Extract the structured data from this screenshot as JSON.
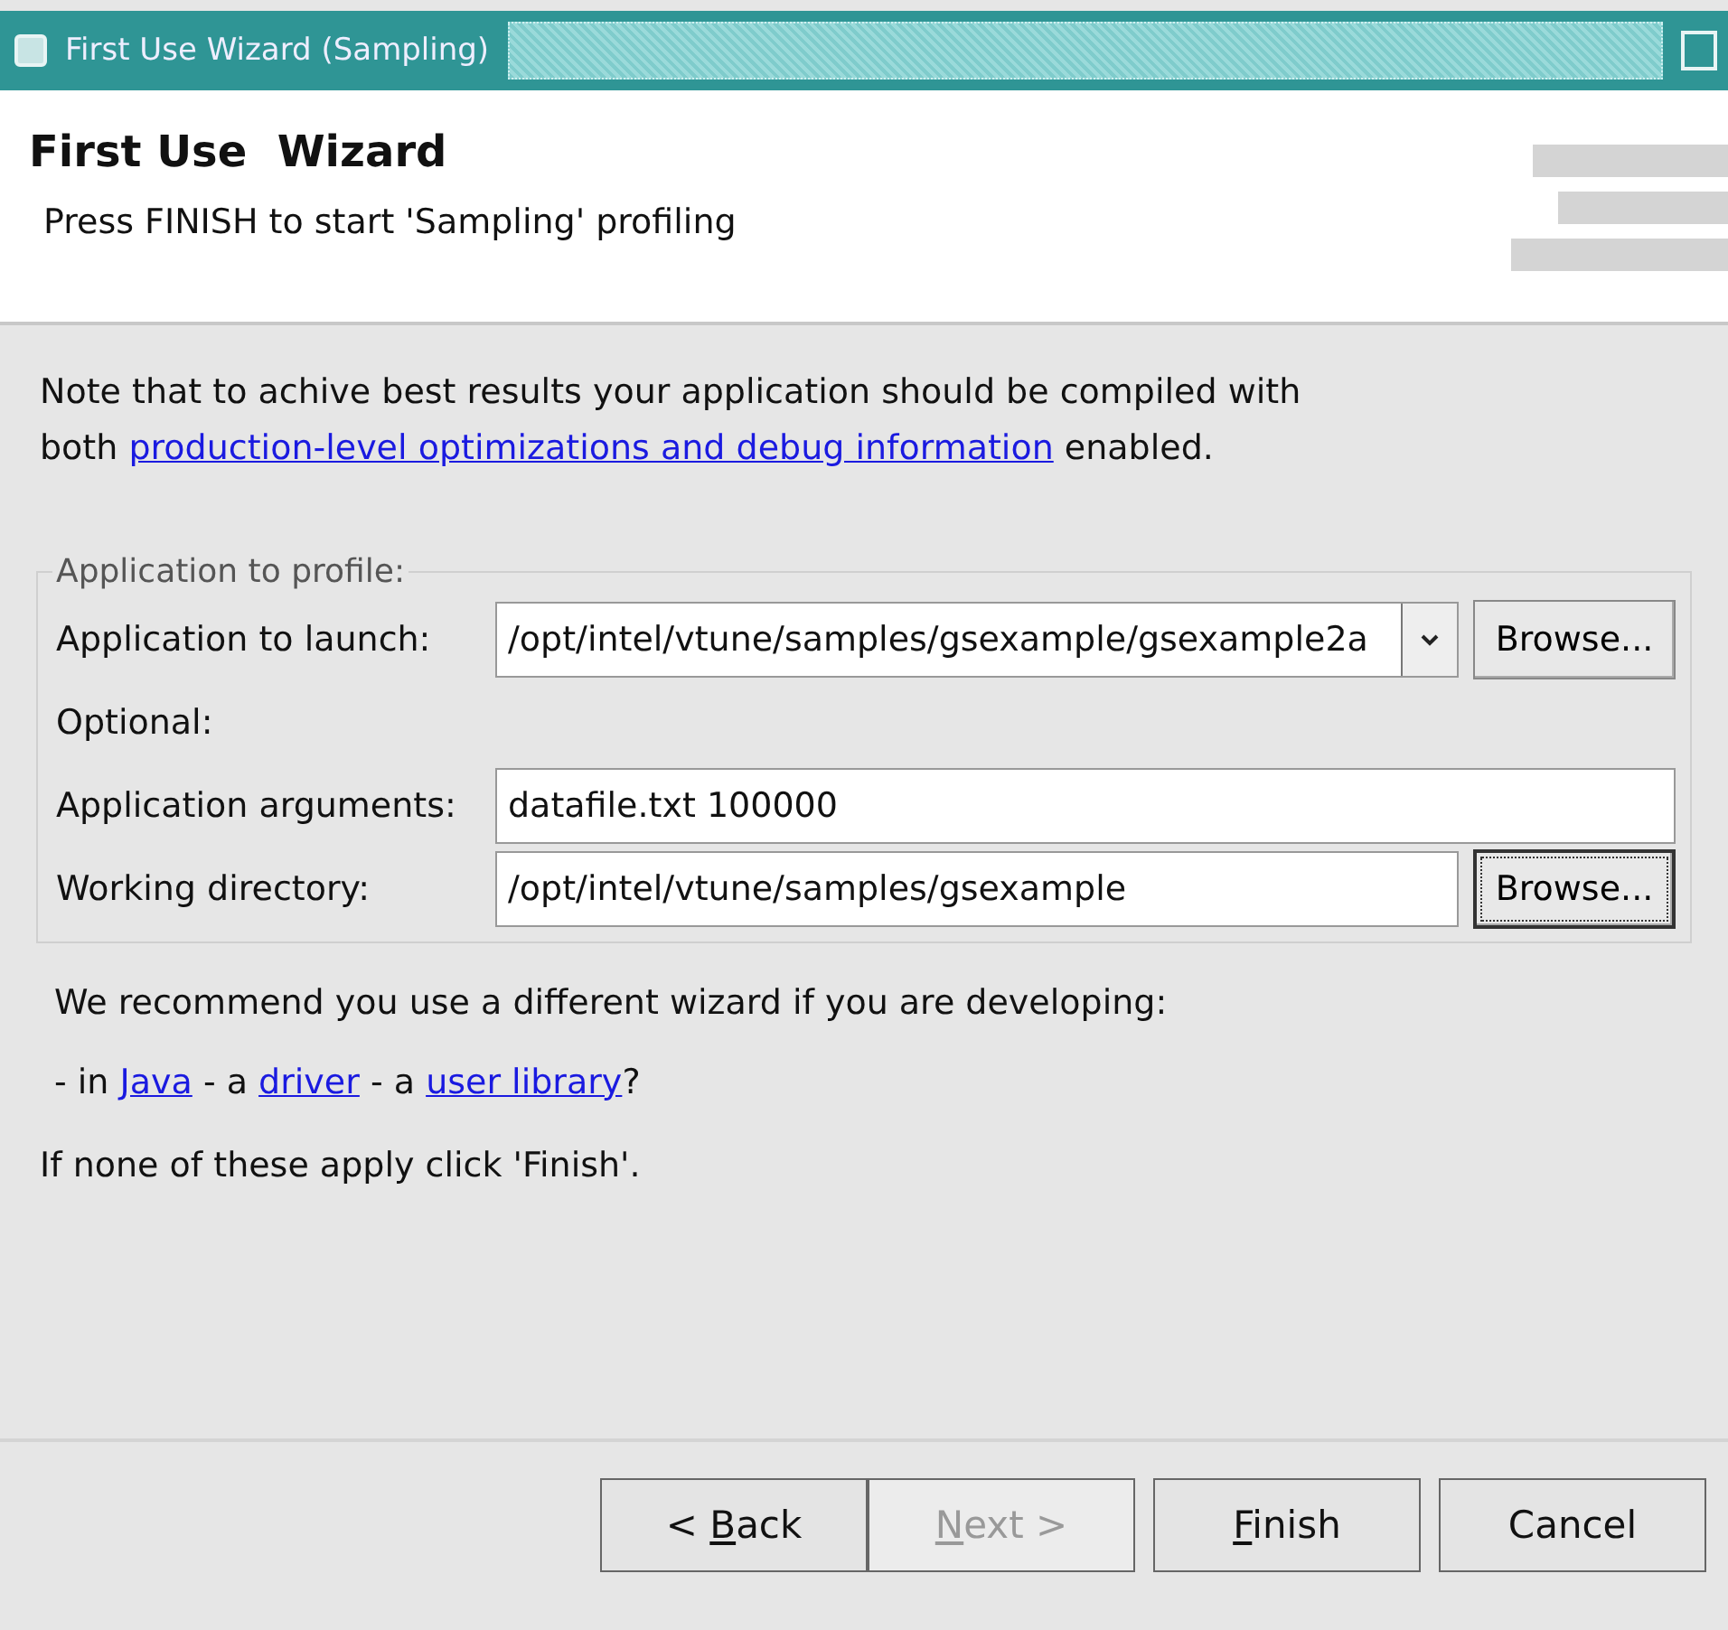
{
  "window": {
    "title": "First Use Wizard (Sampling)"
  },
  "header": {
    "title": "First Use  Wizard",
    "subtitle": "Press FINISH to start 'Sampling' profiling"
  },
  "note": [
    {
      "kind": "text",
      "text": "Note that to achive best results your application should be compiled with both "
    },
    {
      "kind": "link",
      "text": "production-level optimizations and debug information"
    },
    {
      "kind": "text",
      "text": " enabled."
    }
  ],
  "group": {
    "legend": "Application to profile:",
    "launch": {
      "label": "Application to launch:",
      "value": "/opt/intel/vtune/samples/gsexample/gsexample2a",
      "button": "Browse..."
    },
    "optional_label": "Optional:",
    "arguments": {
      "label": "Application arguments:",
      "value": "datafile.txt 100000"
    },
    "directory": {
      "label": "Working directory:",
      "value": "/opt/intel/vtune/samples/gsexample",
      "button": "Browse...",
      "button_focused": true
    }
  },
  "recommend": "We recommend you use a different wizard if you are developing:",
  "choices": [
    {
      "kind": "text",
      "text": "- in "
    },
    {
      "kind": "link",
      "text": "Java"
    },
    {
      "kind": "text",
      "text": " - a "
    },
    {
      "kind": "link",
      "text": "driver"
    },
    {
      "kind": "text",
      "text": " - a "
    },
    {
      "kind": "link",
      "text": "user library"
    },
    {
      "kind": "text",
      "text": "?"
    }
  ],
  "footer_note": "If none of these apply click 'Finish'.",
  "buttons": [
    {
      "before": "< ",
      "key": "B",
      "after": "ack",
      "disabled": false
    },
    {
      "key": "N",
      "after": "ext >",
      "disabled": true
    },
    {
      "key": "F",
      "after": "inish",
      "disabled": false
    },
    {
      "before": "Cancel",
      "disabled": false
    }
  ]
}
